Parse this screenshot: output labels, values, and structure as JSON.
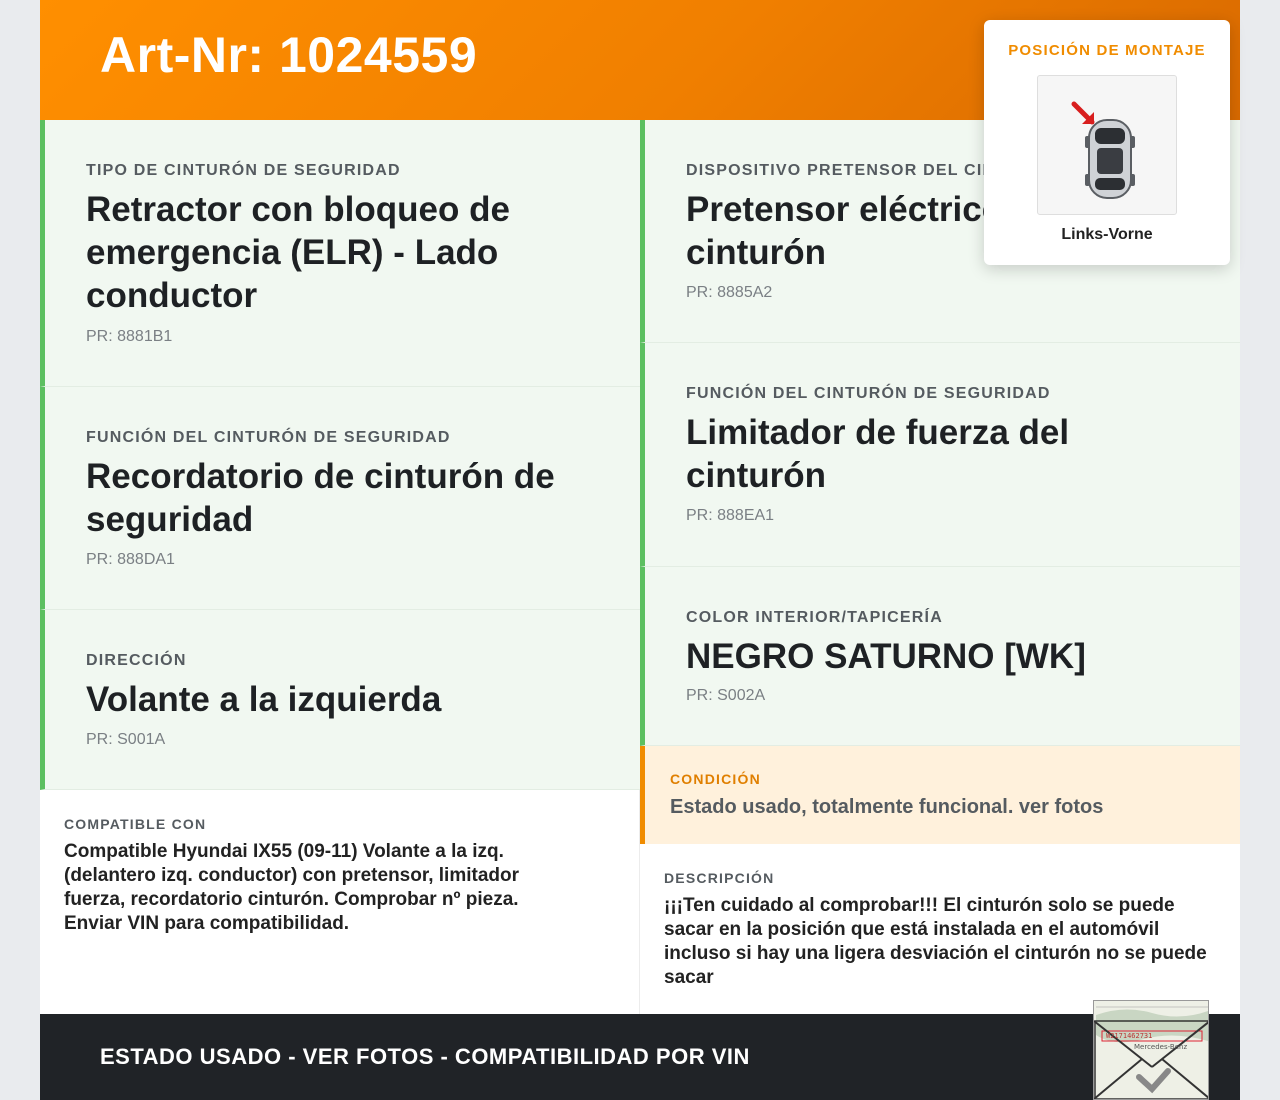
{
  "header": {
    "title": "Art-Nr: 1024559"
  },
  "left_specs": [
    {
      "label": "TIPO DE CINTURÓN DE SEGURIDAD",
      "value": "Retractor con bloqueo de emergencia (ELR) - Lado conductor",
      "pr": "PR: 8881B1"
    },
    {
      "label": "FUNCIÓN DEL CINTURÓN DE SEGURIDAD",
      "value": "Recordatorio de cinturón de seguridad",
      "pr": "PR: 888DA1"
    },
    {
      "label": "DIRECCIÓN",
      "value": "Volante a la izquierda",
      "pr": "PR: S001A"
    }
  ],
  "right_specs": [
    {
      "label": "DISPOSITIVO PRETENSOR DEL CINTURÓN",
      "value": "Pretensor eléctrico del cinturón",
      "pr": "PR: 8885A2"
    },
    {
      "label": "FUNCIÓN DEL CINTURÓN DE SEGURIDAD",
      "value": "Limitador de fuerza del cinturón",
      "pr": "PR: 888EA1"
    },
    {
      "label": "COLOR INTERIOR/TAPICERÍA",
      "value": "NEGRO SATURNO [WK]",
      "pr": "PR: S002A"
    }
  ],
  "compatible": {
    "label": "COMPATIBLE CON",
    "text": "Compatible Hyundai IX55 (09-11) Volante a la izq. (delantero izq. conductor) con pretensor, limitador fuerza, recordatorio cinturón. Comprobar nº pieza. Enviar VIN para compatibilidad."
  },
  "condition": {
    "label": "CONDICIÓN",
    "text": "Estado usado, totalmente funcional. ver fotos"
  },
  "description": {
    "label": "DESCRIPCIÓN",
    "text": "¡¡¡Ten cuidado al comprobar!!! El cinturón solo se puede sacar en la posición que está instalada en el automóvil incluso si hay una ligera desviación el cinturón no se puede sacar"
  },
  "mount": {
    "label": "POSICIÓN DE MONTAJE",
    "caption": "Links-Vorne"
  },
  "footer": {
    "text": "ESTADO USADO - VER FOTOS - COMPATIBILIDAD POR VIN"
  },
  "doc": {
    "line1": "W2171462731",
    "line2": "Mercedes-Benz"
  },
  "colors": {
    "accent": "#ff8f00",
    "green": "#5cbf60",
    "dark": "#202327"
  },
  "icons": [
    "car-top-view-icon",
    "position-arrow-icon",
    "document-envelope-icon"
  ]
}
